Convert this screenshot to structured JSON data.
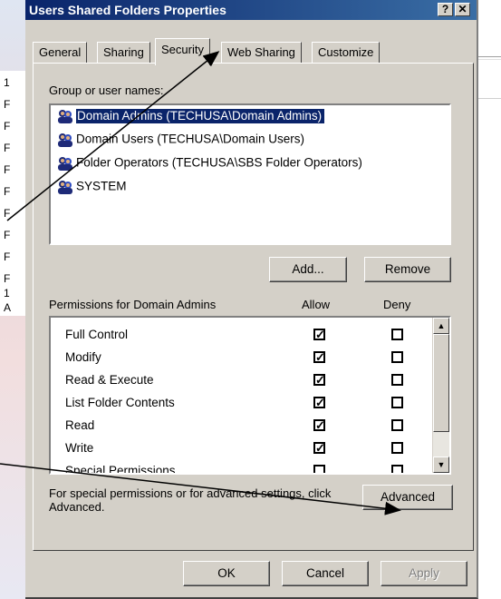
{
  "background": {
    "left_letters": [
      "1",
      "F",
      "F",
      "F",
      "F",
      "F",
      "F",
      "F",
      "F",
      "F",
      "1",
      "A"
    ]
  },
  "dialog": {
    "title": "Users Shared Folders Properties",
    "help_button": "?",
    "close_button": "✕",
    "tabs": [
      {
        "label": "General"
      },
      {
        "label": "Sharing"
      },
      {
        "label": "Security",
        "active": true
      },
      {
        "label": "Web Sharing"
      },
      {
        "label": "Customize"
      }
    ],
    "group_label": "Group or user names:",
    "users": [
      {
        "name": "Domain Admins (TECHUSA\\Domain Admins)",
        "selected": true
      },
      {
        "name": "Domain Users (TECHUSA\\Domain Users)"
      },
      {
        "name": "Folder Operators (TECHUSA\\SBS Folder Operators)"
      },
      {
        "name": "SYSTEM"
      }
    ],
    "add_button": "Add...",
    "remove_button": "Remove",
    "permissions_label": "Permissions for Domain Admins",
    "allow_header": "Allow",
    "deny_header": "Deny",
    "permissions": [
      {
        "name": "Full Control",
        "allow": true,
        "deny": false
      },
      {
        "name": "Modify",
        "allow": true,
        "deny": false
      },
      {
        "name": "Read & Execute",
        "allow": true,
        "deny": false
      },
      {
        "name": "List Folder Contents",
        "allow": true,
        "deny": false
      },
      {
        "name": "Read",
        "allow": true,
        "deny": false
      },
      {
        "name": "Write",
        "allow": true,
        "deny": false
      },
      {
        "name": "Special Permissions",
        "allow": false,
        "deny": false
      }
    ],
    "advanced_text": "For special permissions or for advanced settings, click Advanced.",
    "advanced_button": "Advanced",
    "ok_button": "OK",
    "cancel_button": "Cancel",
    "apply_button": "Apply"
  },
  "colors": {
    "title_start": "#0a246a",
    "title_end": "#3a6ea5",
    "dialog_bg": "#d4d0c8",
    "selection": "#0a246a"
  }
}
